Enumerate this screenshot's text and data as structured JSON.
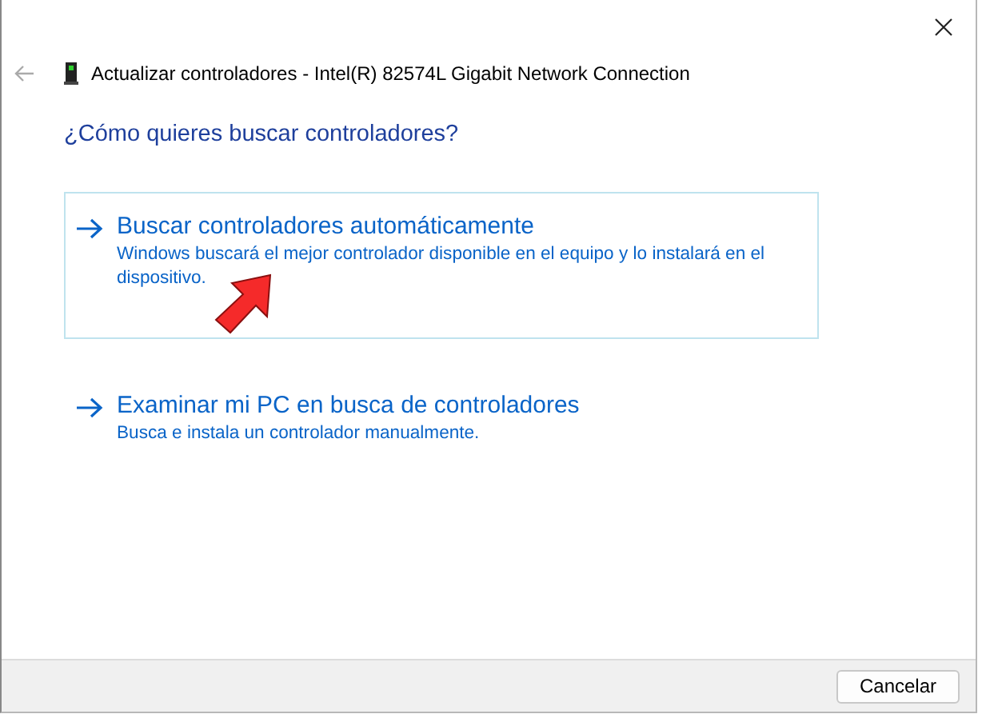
{
  "window": {
    "title": "Actualizar controladores - Intel(R) 82574L Gigabit Network Connection"
  },
  "heading": "¿Cómo quieres buscar controladores?",
  "options": [
    {
      "title": "Buscar controladores automáticamente",
      "description": "Windows buscará el mejor controlador disponible en el equipo y lo instalará en el dispositivo.",
      "selected": true
    },
    {
      "title": "Examinar mi PC en busca de controladores",
      "description": "Busca e instala un controlador manualmente.",
      "selected": false
    }
  ],
  "buttons": [
    {
      "label": "Cancelar"
    }
  ]
}
